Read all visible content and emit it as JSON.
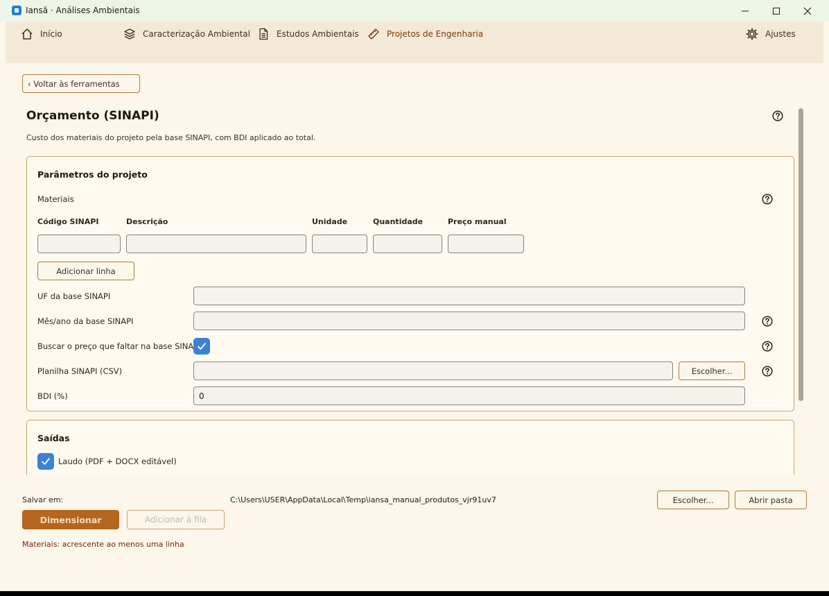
{
  "window": {
    "title": "Iansã · Análises Ambientais"
  },
  "nav": {
    "inicio": "Início",
    "caracterizacao": "Caracterização Ambiental",
    "estudos": "Estudos Ambientais",
    "projetos": "Projetos de Engenharia",
    "ajustes": "Ajustes"
  },
  "back_label": "‹ Voltar às ferramentas",
  "page": {
    "title": "Orçamento (SINAPI)",
    "description": "Custo dos materiais do projeto pela base SINAPI, com BDI aplicado ao total."
  },
  "params": {
    "title": "Parâmetros do projeto",
    "materials_label": "Materiais",
    "columns": {
      "codigo": "Código SINAPI",
      "descricao": "Descrição",
      "unidade": "Unidade",
      "quantidade": "Quantidade",
      "preco": "Preço manual"
    },
    "row_values": {
      "codigo": "",
      "descricao": "",
      "unidade": "",
      "quantidade": "",
      "preco": ""
    },
    "add_row": "Adicionar linha",
    "uf_label": "UF da base SINAPI",
    "uf_value": "",
    "mes_label": "Mês/ano da base SINAPI",
    "mes_value": "",
    "buscar_label": "Buscar o preço que faltar na base SINAPI",
    "buscar_checked": true,
    "planilha_label": "Planilha SINAPI (CSV)",
    "planilha_value": "",
    "planilha_button": "Escolher...",
    "bdi_label": "BDI (%)",
    "bdi_value": "0"
  },
  "saidas": {
    "title": "Saídas",
    "laudo_label": "Laudo (PDF + DOCX editável)",
    "laudo_checked": true
  },
  "footer": {
    "save_label": "Salvar em:",
    "save_path": "C:\\Users\\USER\\AppData\\Local\\Temp\\iansa_manual_produtos_vjr91uv7",
    "choose_button": "Escolher...",
    "open_folder_button": "Abrir pasta",
    "primary_button": "Dimensionar",
    "queue_button": "Adicionar à fila",
    "error": "Materiais: acrescente ao menos uma linha"
  },
  "colors": {
    "accent": "#b5651d",
    "checkbox": "#3b82d6",
    "border": "#c9a46f",
    "background": "#fdf6ea"
  }
}
